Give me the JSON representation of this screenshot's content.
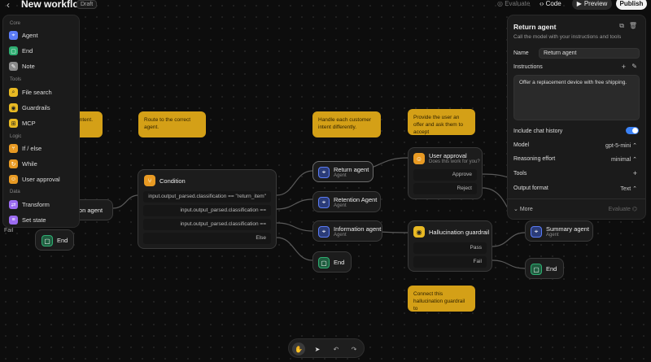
{
  "topbar": {
    "back_icon": "chevron-left-icon",
    "title": "New workflow",
    "draft_badge": "Draft",
    "evaluate": "Evaluate",
    "code": "Code",
    "preview": "Preview",
    "publish": "Publish"
  },
  "palette": {
    "core_label": "Core",
    "core": [
      {
        "label": "Agent",
        "color": "#5b7cf7",
        "icon": "agent-icon"
      },
      {
        "label": "End",
        "color": "#2fae72",
        "icon": "stop-icon"
      },
      {
        "label": "Note",
        "color": "#8a8a8a",
        "icon": "note-icon"
      }
    ],
    "tools_label": "Tools",
    "tools": [
      {
        "label": "File search",
        "color": "#e8b923",
        "icon": "file-search-icon"
      },
      {
        "label": "Guardrails",
        "color": "#e8b923",
        "icon": "shield-icon"
      },
      {
        "label": "MCP",
        "color": "#e8b923",
        "icon": "mcp-icon"
      }
    ],
    "logic_label": "Logic",
    "logic": [
      {
        "label": "If / else",
        "color": "#e89a23",
        "icon": "branch-icon"
      },
      {
        "label": "While",
        "color": "#e89a23",
        "icon": "loop-icon"
      },
      {
        "label": "User approval",
        "color": "#e89a23",
        "icon": "approval-icon"
      }
    ],
    "data_label": "Data",
    "data": [
      {
        "label": "Transform",
        "color": "#9b6bf0",
        "icon": "transform-icon"
      },
      {
        "label": "Set state",
        "color": "#9b6bf0",
        "icon": "state-icon"
      }
    ]
  },
  "canvas": {
    "notes": {
      "intent": "'s intent.",
      "route": "Route to the correct agent.",
      "handle": "Handle each customer intent differently.",
      "offer": "Provide the user an offer and ask them to accept",
      "connect": "Connect this hallucination guardrail to"
    },
    "partial_agent": "ation agent",
    "partial_fail": "Fail",
    "end_label": "End",
    "condition": {
      "title": "Condition",
      "rows": [
        "input.output_parsed.classification == \"return_item\"",
        "input.output_parsed.classification == \"cancel_subscription\"",
        "input.output_parsed.classification == \"get_information\"",
        "Else"
      ]
    },
    "agents": {
      "return": {
        "title": "Return agent",
        "sub": "Agent"
      },
      "retention": {
        "title": "Retention Agent",
        "sub": "Agent"
      },
      "information": {
        "title": "Information agent",
        "sub": "Agent"
      },
      "summary": {
        "title": "Summary agent",
        "sub": "Agent"
      }
    },
    "approval": {
      "title": "User approval",
      "sub": "Does this work for you?",
      "approve": "Approve",
      "reject": "Reject"
    },
    "guardrail": {
      "title": "Hallucination guardrail",
      "pass": "Pass",
      "fail": "Fail"
    }
  },
  "panel": {
    "title": "Return agent",
    "subtitle": "Call the model with your instructions and tools",
    "name_label": "Name",
    "name_value": "Return agent",
    "instructions_label": "Instructions",
    "instructions_value": "Offer a replacement device with free shipping.",
    "chat_history_label": "Include chat history",
    "chat_history_on": true,
    "model_label": "Model",
    "model_value": "gpt-5-mini",
    "reasoning_label": "Reasoning effort",
    "reasoning_value": "minimal",
    "tools_label": "Tools",
    "output_label": "Output format",
    "output_value": "Text",
    "more": "More",
    "evaluate": "Evaluate"
  },
  "colors": {
    "accent": "#3b82f6",
    "note": "#d4a017",
    "agent": "#5b7cf7",
    "end": "#2fae72",
    "logic": "#e89a23",
    "guardrail": "#e8b923"
  }
}
